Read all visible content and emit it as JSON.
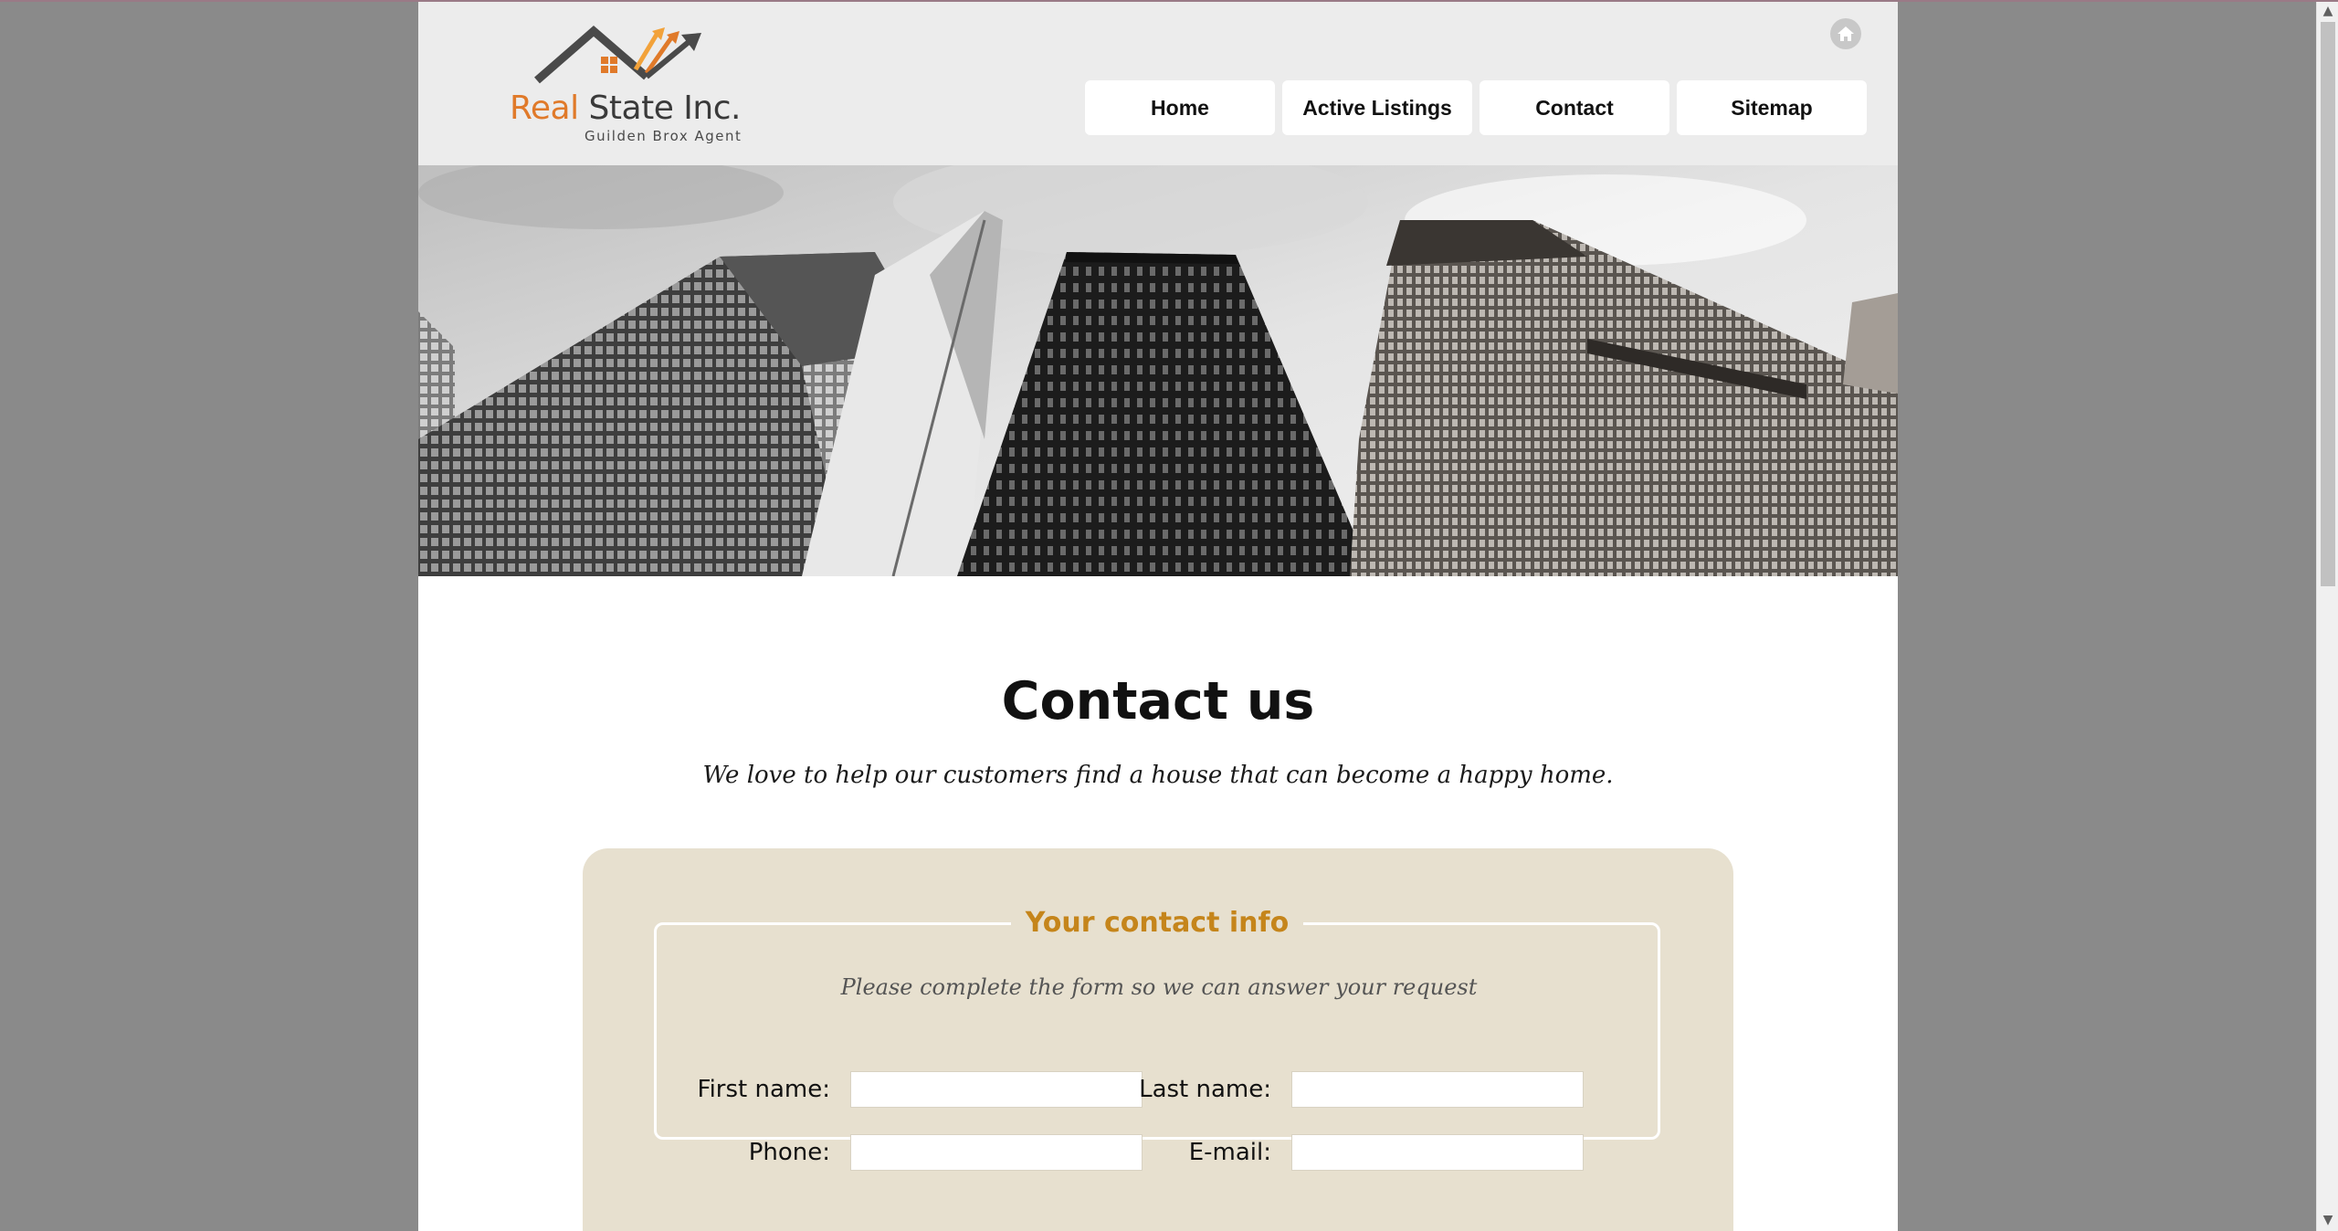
{
  "header": {
    "logo": {
      "word_real": "Real",
      "word_rest": " State Inc.",
      "tagline": "Guilden Brox Agent"
    },
    "home_icon": "home-icon"
  },
  "nav": {
    "items": [
      {
        "label": "Home"
      },
      {
        "label": "Active Listings"
      },
      {
        "label": "Contact"
      },
      {
        "label": "Sitemap"
      }
    ]
  },
  "hero": {
    "image": "skyscrapers-black-white-photo"
  },
  "main": {
    "title": "Contact us",
    "subtitle": "We love to help our customers find a house that can become a happy home."
  },
  "form": {
    "legend": "Your contact info",
    "note": "Please complete the form so we can answer your request",
    "fields": {
      "first_name": {
        "label": "First name:",
        "value": ""
      },
      "last_name": {
        "label": "Last name:",
        "value": ""
      },
      "phone": {
        "label": "Phone:",
        "value": ""
      },
      "email": {
        "label": "E-mail:",
        "value": ""
      }
    }
  },
  "colors": {
    "brand_orange": "#e07a2a",
    "legend_gold": "#c5851b",
    "form_panel": "#e7e0cf",
    "header_bg": "#ececec",
    "outer_bg": "#8a8a8a"
  },
  "scrollbar": {
    "up_arrow": "▲",
    "down_arrow": "▼"
  }
}
